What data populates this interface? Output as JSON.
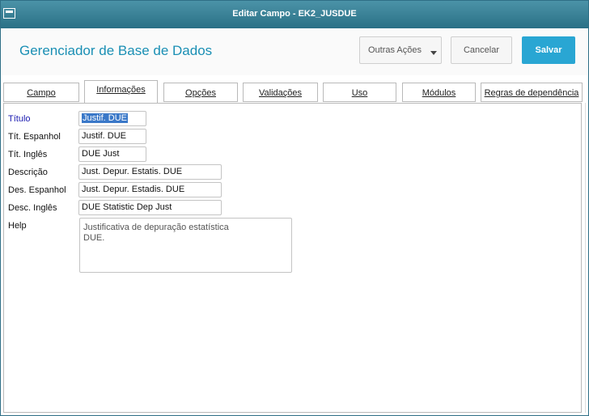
{
  "window": {
    "title": "Editar Campo - EK2_JUSDUE"
  },
  "header": {
    "app_title": "Gerenciador de Base de Dados",
    "buttons": {
      "outras": "Outras Ações",
      "cancelar": "Cancelar",
      "salvar": "Salvar"
    },
    "accent_color": "#29a6d3"
  },
  "tabs": [
    {
      "label": "Campo"
    },
    {
      "label": "Informações",
      "active": true
    },
    {
      "label": "Opções"
    },
    {
      "label": "Validações"
    },
    {
      "label": "Uso"
    },
    {
      "label": "Módulos"
    },
    {
      "label": "Regras de dependência"
    }
  ],
  "form": {
    "titulo": {
      "label": "Título",
      "value": "Justif. DUE"
    },
    "tit_espanhol": {
      "label": "Tít. Espanhol",
      "value": "Justif. DUE"
    },
    "tit_ingles": {
      "label": "Tít. Inglês",
      "value": "DUE Just"
    },
    "descricao": {
      "label": "Descrição",
      "value": "Just. Depur. Estatis. DUE"
    },
    "des_espanhol": {
      "label": "Des. Espanhol",
      "value": "Just. Depur. Estadis. DUE"
    },
    "desc_ingles": {
      "label": "Desc. Inglês",
      "value": "DUE Statistic Dep Just"
    },
    "help": {
      "label": "Help",
      "line1": "Justificativa de depuração estatística",
      "line2": "DUE."
    }
  }
}
